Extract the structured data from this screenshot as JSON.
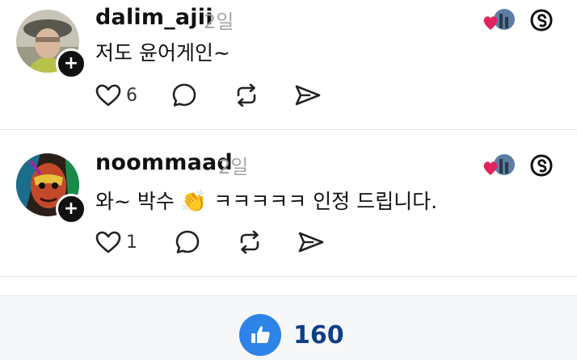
{
  "comments": [
    {
      "username": "dalim_ajii",
      "time": "2일",
      "text": "저도 윤어게인~",
      "like_count": "6",
      "avatar_icon": "profile-photo-man-with-hat",
      "badge_icon": "plus-icon"
    },
    {
      "username": "noommaad",
      "time": "2일",
      "text_before_emoji": "와~ 박수",
      "emoji": "👏",
      "text_after_emoji": "ㅋㅋㅋㅋㅋ 인정 드립니다.",
      "like_count": "1",
      "avatar_icon": "profile-painted-face",
      "badge_icon": "plus-icon"
    }
  ],
  "icons": {
    "like": "heart-icon",
    "reply": "comment-bubble-icon",
    "repost": "repost-icon",
    "share": "send-icon",
    "liked_by": "liked-by-avatar-with-heart",
    "platform": "threads-logo-icon"
  },
  "footer": {
    "like_icon": "thumbs-up-icon",
    "like_total": "160"
  },
  "colors": {
    "heart_red": "#e0245e",
    "like_blue": "#2d83e7",
    "count_navy": "#0f3e86",
    "time_gray": "#a6a6a6"
  }
}
